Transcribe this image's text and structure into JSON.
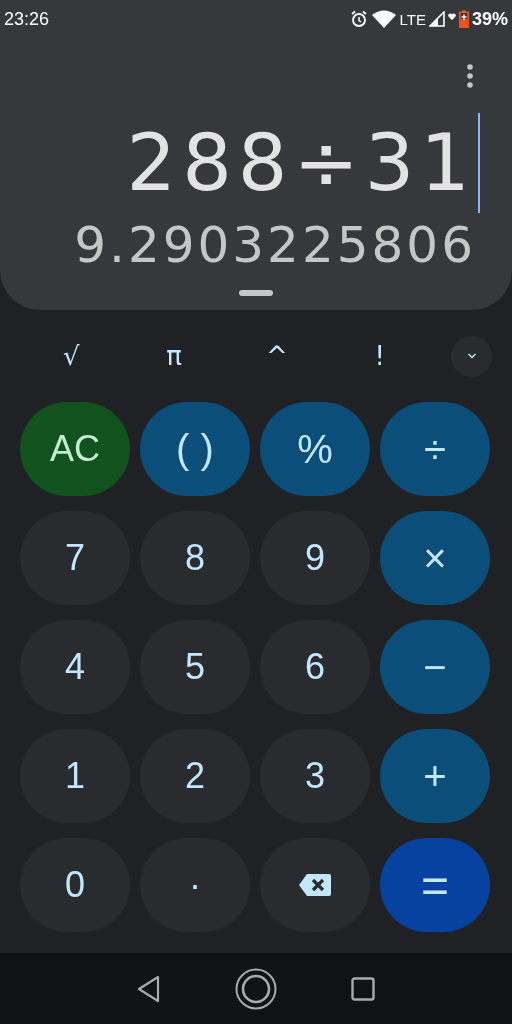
{
  "status_bar": {
    "time": "23:26",
    "network": "LTE",
    "battery": "39%"
  },
  "display": {
    "expression": "288÷31",
    "result": "9.2903225806"
  },
  "scientific_keys": [
    "√",
    "π",
    "^",
    "!"
  ],
  "keys": [
    {
      "kind": "clear",
      "label": "AC"
    },
    {
      "kind": "op",
      "label": "( )"
    },
    {
      "kind": "op",
      "label": "%"
    },
    {
      "kind": "op",
      "label": "÷"
    },
    {
      "kind": "digit",
      "label": "7"
    },
    {
      "kind": "digit",
      "label": "8"
    },
    {
      "kind": "digit",
      "label": "9"
    },
    {
      "kind": "op",
      "label": "×"
    },
    {
      "kind": "digit",
      "label": "4"
    },
    {
      "kind": "digit",
      "label": "5"
    },
    {
      "kind": "digit",
      "label": "6"
    },
    {
      "kind": "op",
      "label": "−"
    },
    {
      "kind": "digit",
      "label": "1"
    },
    {
      "kind": "digit",
      "label": "2"
    },
    {
      "kind": "digit",
      "label": "3"
    },
    {
      "kind": "op",
      "label": "+"
    },
    {
      "kind": "digit",
      "label": "0"
    },
    {
      "kind": "digit",
      "label": "·"
    },
    {
      "kind": "backspace"
    },
    {
      "kind": "equals",
      "label": "="
    }
  ]
}
